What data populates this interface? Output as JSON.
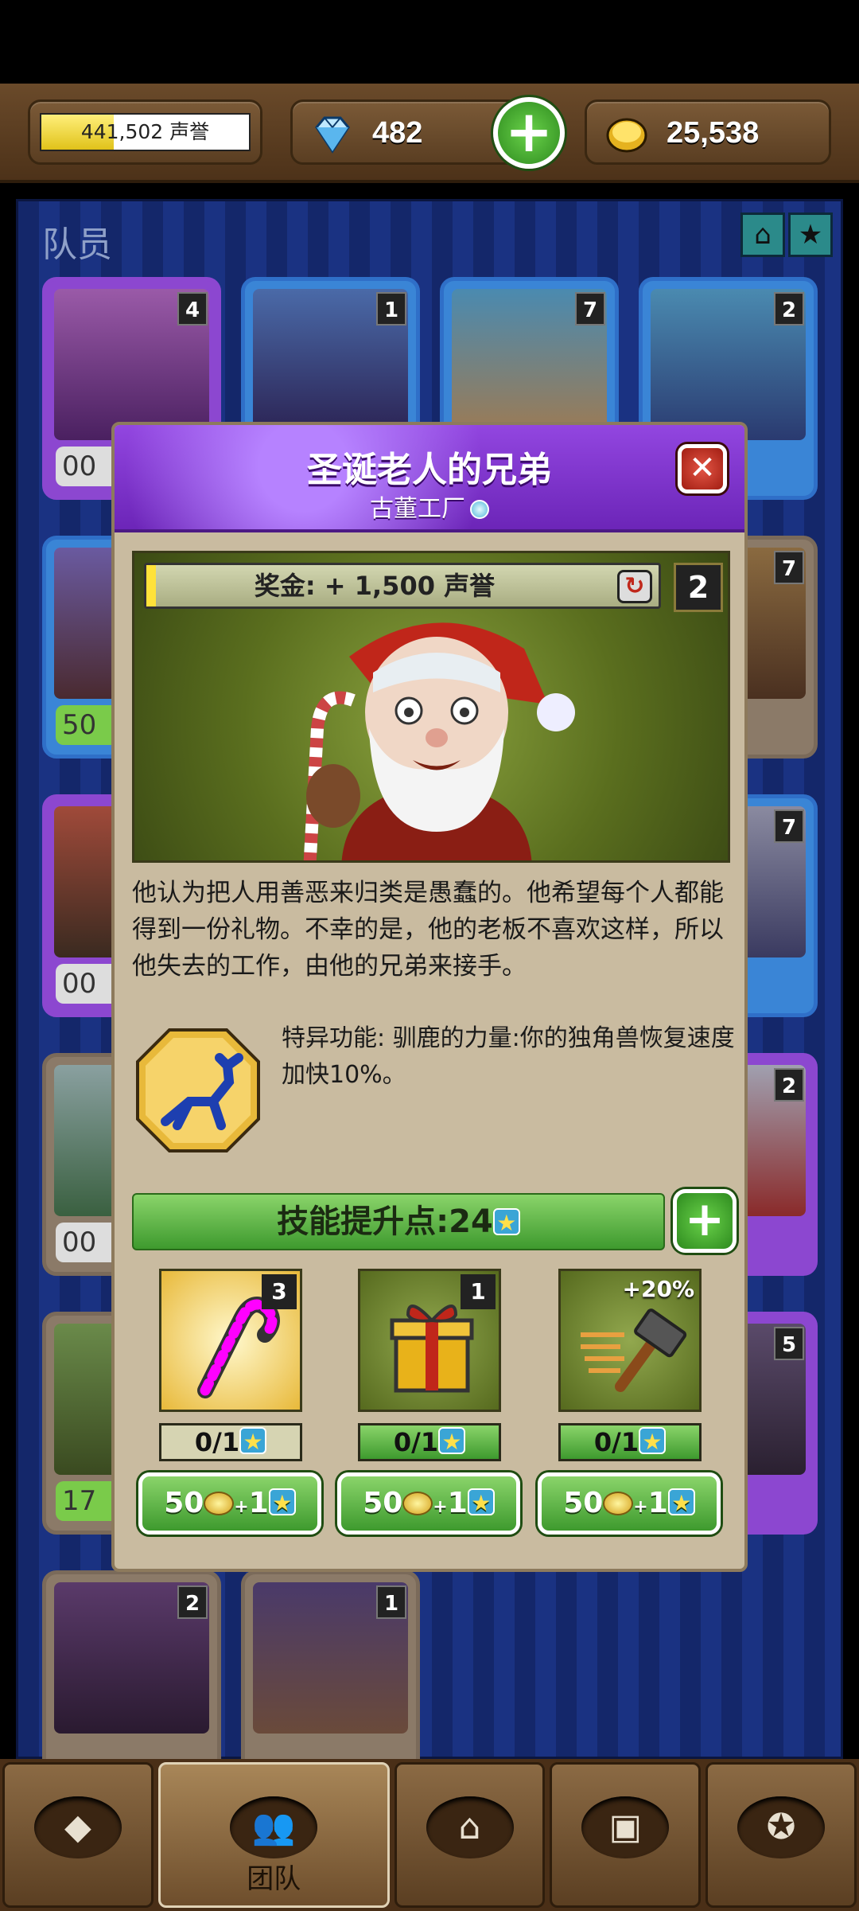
{
  "resources": {
    "reputation": "441,502 声誉",
    "reputation_progress": 0.35,
    "gems": "482",
    "gold": "25,538",
    "add_label": "+"
  },
  "team": {
    "title": "队员",
    "cards": [
      {
        "level": "4",
        "bar": "00"
      },
      {
        "level": "1",
        "bar": ""
      },
      {
        "level": "7",
        "bar": ""
      },
      {
        "level": "2",
        "bar": ""
      },
      {
        "level": "",
        "bar": "50"
      },
      {
        "level": "7",
        "bar": ""
      },
      {
        "level": "",
        "bar": "00"
      },
      {
        "level": "7",
        "bar": ""
      },
      {
        "level": "",
        "bar": "00"
      },
      {
        "level": "2",
        "bar": ""
      },
      {
        "level": "",
        "bar": "17"
      },
      {
        "level": "5",
        "bar": ""
      },
      {
        "level": "2",
        "bar": ""
      },
      {
        "level": "1",
        "bar": ""
      }
    ]
  },
  "dialog": {
    "title": "圣诞老人的兄弟",
    "subtitle": "古董工厂",
    "bonus": "奖金: + 1,500 声誉",
    "level": "2",
    "description": "他认为把人用善恶来归类是愚蠢的。他希望每个人都能得到一份礼物。不幸的是，他的老板不喜欢这样，所以他失去的工作，由他的兄弟来接手。",
    "ability": "特异功能: 驯鹿的力量:你的独角兽恢复速度加快10%。",
    "skill_points_label": "技能提升点:24",
    "skills": [
      {
        "icon": "candy-cane-icon",
        "badge": "3",
        "progress": "0/1",
        "cost_gold": "50",
        "cost_star": "1"
      },
      {
        "icon": "gift-box-icon",
        "badge": "1",
        "progress": "0/1",
        "cost_gold": "50",
        "cost_star": "1"
      },
      {
        "icon": "hammer-icon",
        "badge": "+20%",
        "progress": "0/1",
        "cost_gold": "50",
        "cost_star": "1"
      }
    ]
  },
  "nav": {
    "tabs": [
      {
        "icon": "diamond-icon",
        "label": ""
      },
      {
        "icon": "team-icon",
        "label": "团队"
      },
      {
        "icon": "buildings-icon",
        "label": ""
      },
      {
        "icon": "treasure-chest-icon",
        "label": ""
      },
      {
        "icon": "medal-icon",
        "label": ""
      }
    ]
  },
  "colors": {
    "accent_purple": "#7b33c8",
    "accent_green": "#4fae35",
    "wood": "#5b3f22"
  }
}
